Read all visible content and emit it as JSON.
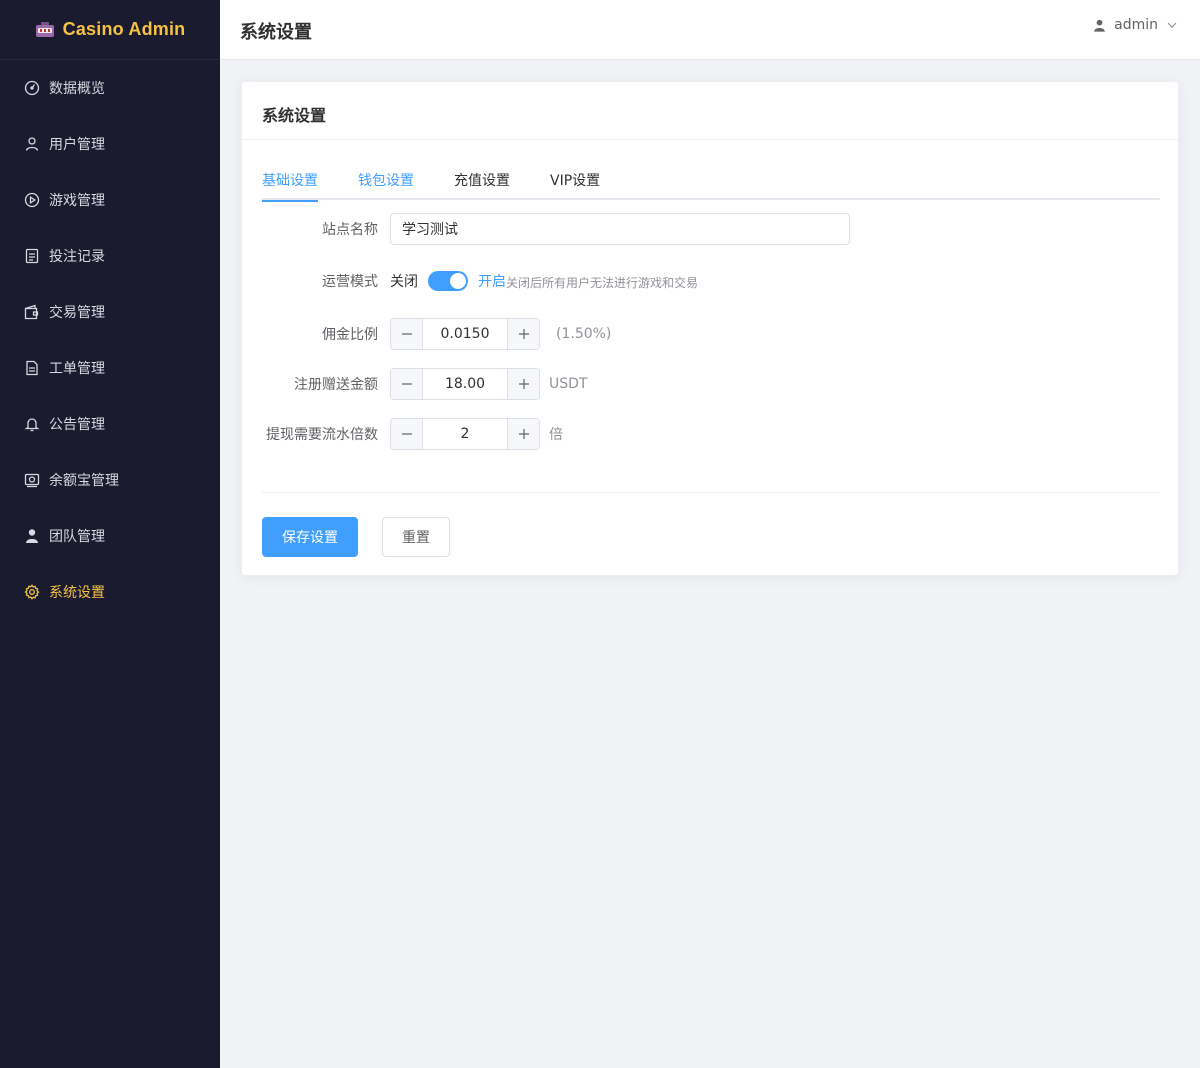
{
  "app": {
    "logo_text": "Casino Admin"
  },
  "sidebar": {
    "items": [
      {
        "label": "数据概览",
        "icon": "dashboard-icon"
      },
      {
        "label": "用户管理",
        "icon": "user-icon"
      },
      {
        "label": "游戏管理",
        "icon": "play-circle-icon"
      },
      {
        "label": "投注记录",
        "icon": "document-icon"
      },
      {
        "label": "交易管理",
        "icon": "wallet-icon"
      },
      {
        "label": "工单管理",
        "icon": "ticket-icon"
      },
      {
        "label": "公告管理",
        "icon": "bell-icon"
      },
      {
        "label": "余额宝管理",
        "icon": "money-icon"
      },
      {
        "label": "团队管理",
        "icon": "team-icon"
      },
      {
        "label": "系统设置",
        "icon": "gear-icon",
        "active": true
      }
    ]
  },
  "header": {
    "title": "系统设置",
    "username": "admin"
  },
  "card": {
    "title": "系统设置",
    "tabs": [
      {
        "label": "基础设置",
        "active": true
      },
      {
        "label": "钱包设置"
      },
      {
        "label": "充值设置"
      },
      {
        "label": "VIP设置"
      }
    ],
    "form": {
      "site_name": {
        "label": "站点名称",
        "value": "学习测试"
      },
      "operation_mode": {
        "label": "运营模式",
        "off_text": "关闭",
        "on_text": "开启",
        "hint": "关闭后所有用户无法进行游戏和交易",
        "enabled": true
      },
      "commission": {
        "label": "佣金比例",
        "value": "0.0150",
        "suffix": "(1.50%)"
      },
      "register_bonus": {
        "label": "注册赠送金额",
        "value": "18.00",
        "suffix": "USDT"
      },
      "withdraw_multiplier": {
        "label": "提现需要流水倍数",
        "value": "2",
        "suffix": "倍"
      }
    },
    "buttons": {
      "save": "保存设置",
      "reset": "重置"
    }
  },
  "colors": {
    "sidebar_bg": "#1b1b2f",
    "accent": "#f5c242",
    "primary": "#409eff"
  }
}
